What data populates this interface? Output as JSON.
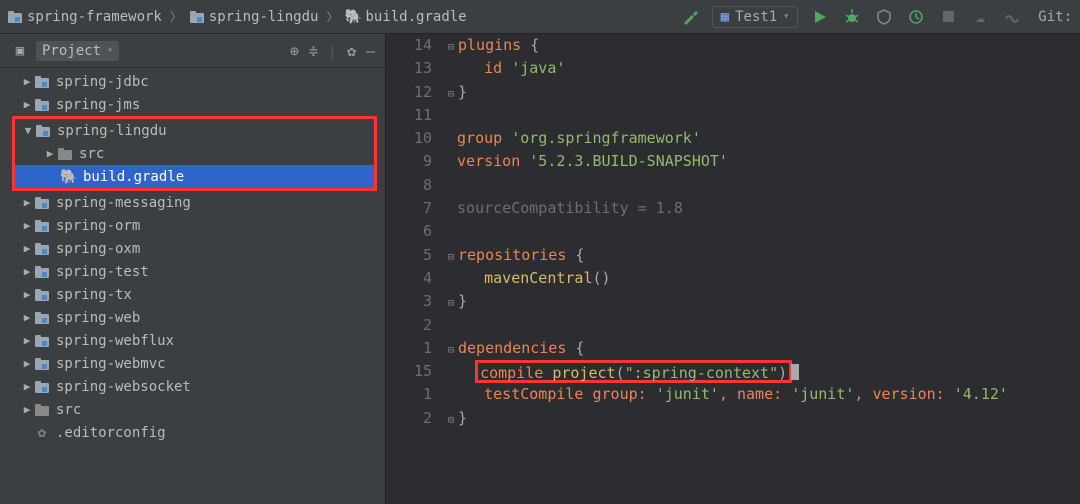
{
  "breadcrumbs": [
    "spring-framework",
    "spring-lingdu",
    "build.gradle"
  ],
  "run_config": "Test1",
  "git_label": "Git:",
  "sidebar": {
    "title": "Project",
    "items": [
      "spring-jdbc",
      "spring-jms",
      "spring-lingdu",
      "src",
      "build.gradle",
      "spring-messaging",
      "spring-orm",
      "spring-oxm",
      "spring-test",
      "spring-tx",
      "spring-web",
      "spring-webflux",
      "spring-webmvc",
      "spring-websocket",
      "src",
      ".editorconfig"
    ]
  },
  "gutter": [
    "14",
    "13",
    "12",
    "11",
    "10",
    "9",
    "8",
    "7",
    "6",
    "5",
    "4",
    "3",
    "2",
    "1",
    "15",
    "1",
    "2"
  ],
  "code": {
    "plugins_kw": "plugins",
    "brace_open": " {",
    "id_kw": "id",
    "java_str": "'java'",
    "brace_close": "}",
    "group_kw": "group",
    "group_val": "'org.springframework'",
    "version_kw": "version",
    "version_val": "'5.2.3.BUILD-SNAPSHOT'",
    "src_compat": "sourceCompatibility = 1.8",
    "repos_kw": "repositories",
    "maven_fn": "mavenCentral",
    "paren": "()",
    "deps_kw": "dependencies",
    "compile_kw": "compile",
    "project_fn": " project",
    "ctx_str": "\":spring-context\"",
    "test_kw": "testCompile",
    "tc_rest": " group: ",
    "junit1": "'junit'",
    "name_lbl": ", name: ",
    "junit2": "'junit'",
    "ver_lbl": ", version: ",
    "ver_val": "'4.12'"
  }
}
